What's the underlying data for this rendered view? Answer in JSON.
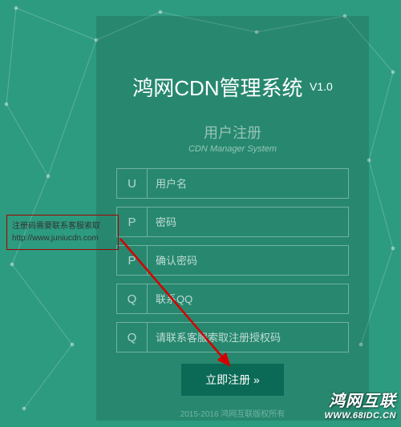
{
  "title": {
    "main": "鸿网CDN管理系统",
    "version": "V1.0"
  },
  "subtitle": {
    "cn": "用户注册",
    "en": "CDN Manager System"
  },
  "fields": [
    {
      "prefix": "U",
      "placeholder": "用户名"
    },
    {
      "prefix": "P",
      "placeholder": "密码"
    },
    {
      "prefix": "P",
      "placeholder": "确认密码"
    },
    {
      "prefix": "Q",
      "placeholder": "联系QQ"
    },
    {
      "prefix": "Q",
      "placeholder": "请联系客服索取注册授权码"
    }
  ],
  "submit_label": "立即注册 »",
  "copyright": "2015-2016 鸿网互联版权所有",
  "note": {
    "text": "注册码需要联系客服索取",
    "url": "http://www.juniucdn.com"
  },
  "watermark": {
    "cn": "鸿网互联",
    "url": "WWW.68IDC.CN"
  },
  "colors": {
    "bg": "#2d9b7f",
    "button": "#0a6a56",
    "note_border": "#a30000",
    "arrow": "#d40000"
  }
}
